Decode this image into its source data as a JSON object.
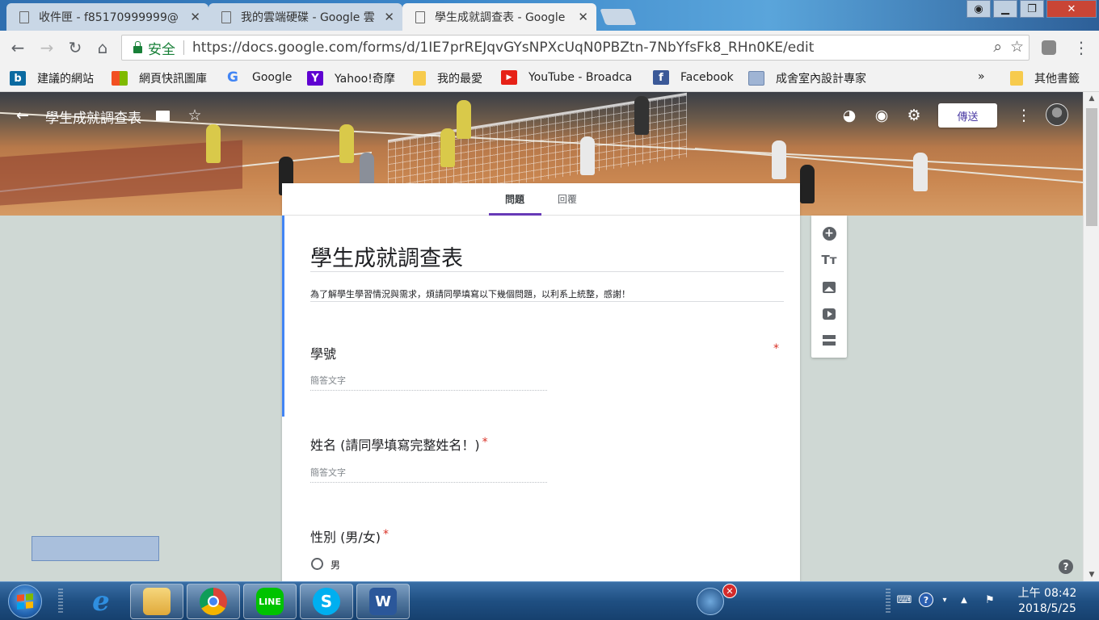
{
  "browser": {
    "tabs": [
      {
        "title": "收件匣 - f85170999999@"
      },
      {
        "title": "我的雲端硬碟 - Google 雲"
      },
      {
        "title": "學生成就調查表 - Google"
      }
    ],
    "security_label": "安全",
    "url": "https://docs.google.com/forms/d/1IE7prREJqvGYsNPXcUqN0PBZtn-7NbYfsFk8_RHn0KE/edit",
    "bookmarks": [
      {
        "label": "建議的網站",
        "icon": "bing-icon"
      },
      {
        "label": "網頁快訊圖庫",
        "icon": "windows-icon"
      },
      {
        "label": "Google",
        "icon": "google-icon"
      },
      {
        "label": "Yahoo!奇摩",
        "icon": "yahoo-icon"
      },
      {
        "label": "我的最愛",
        "icon": "folder-icon"
      },
      {
        "label": "YouTube - Broadca",
        "icon": "youtube-icon"
      },
      {
        "label": "Facebook",
        "icon": "facebook-icon"
      },
      {
        "label": "成舍室內設計專家",
        "icon": "page-icon"
      }
    ],
    "more_bookmarks": "»",
    "other_bookmarks": "其他書籤"
  },
  "forms_header": {
    "title": "學生成就調查表",
    "send_label": "傳送"
  },
  "form": {
    "tabs": [
      {
        "label": "問題"
      },
      {
        "label": "回覆"
      }
    ],
    "title": "學生成就調查表",
    "description": "為了解學生學習情況與需求，煩請同學填寫以下幾個問題，以利系上統整，感謝！",
    "required_mark": "*",
    "questions": [
      {
        "label": "學號",
        "placeholder": "簡答文字"
      },
      {
        "label": "姓名 (請同學填寫完整姓名！)",
        "placeholder": "簡答文字"
      },
      {
        "label": "性別 (男/女)",
        "options": [
          "男"
        ]
      }
    ]
  },
  "help_label": "?",
  "taskbar": {
    "clock_time": "上午 08:42",
    "clock_date": "2018/5/25",
    "line_label": "LINE"
  },
  "colors": {
    "accent": "#673ab7",
    "active_question": "#4285f4",
    "required": "#d93025",
    "secure": "#188038"
  }
}
